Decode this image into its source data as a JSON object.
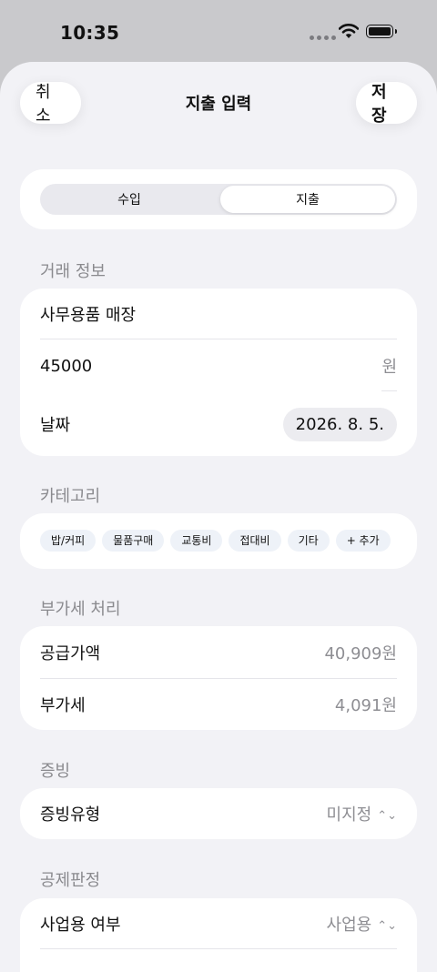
{
  "status": {
    "time": "10:35"
  },
  "nav": {
    "cancel": "취소",
    "title": "지출 입력",
    "save": "저장"
  },
  "type_toggle": {
    "income": "수입",
    "expense": "지출",
    "selected": "지출"
  },
  "transaction": {
    "section": "거래 정보",
    "merchant": "사무용품 매장",
    "amount": "45000",
    "amount_unit": "원",
    "date_label": "날짜",
    "date_value": "2026. 8. 5."
  },
  "category": {
    "section": "카테고리",
    "chips": [
      "밥/커피",
      "물품구매",
      "교통비",
      "접대비",
      "기타",
      "+ 추가"
    ]
  },
  "vat": {
    "section": "부가세 처리",
    "supply_label": "공급가액",
    "supply_value": "40,909원",
    "vat_label": "부가세",
    "vat_value": "4,091원"
  },
  "evidence": {
    "section": "증빙",
    "type_label": "증빙유형",
    "type_value": "미지정"
  },
  "deduction": {
    "section": "공제판정",
    "business_label": "사업용 여부",
    "business_value": "사업용"
  },
  "icons": {
    "wifi": "wifi-icon",
    "battery": "battery-icon",
    "select": "chevron-updown-icon"
  }
}
